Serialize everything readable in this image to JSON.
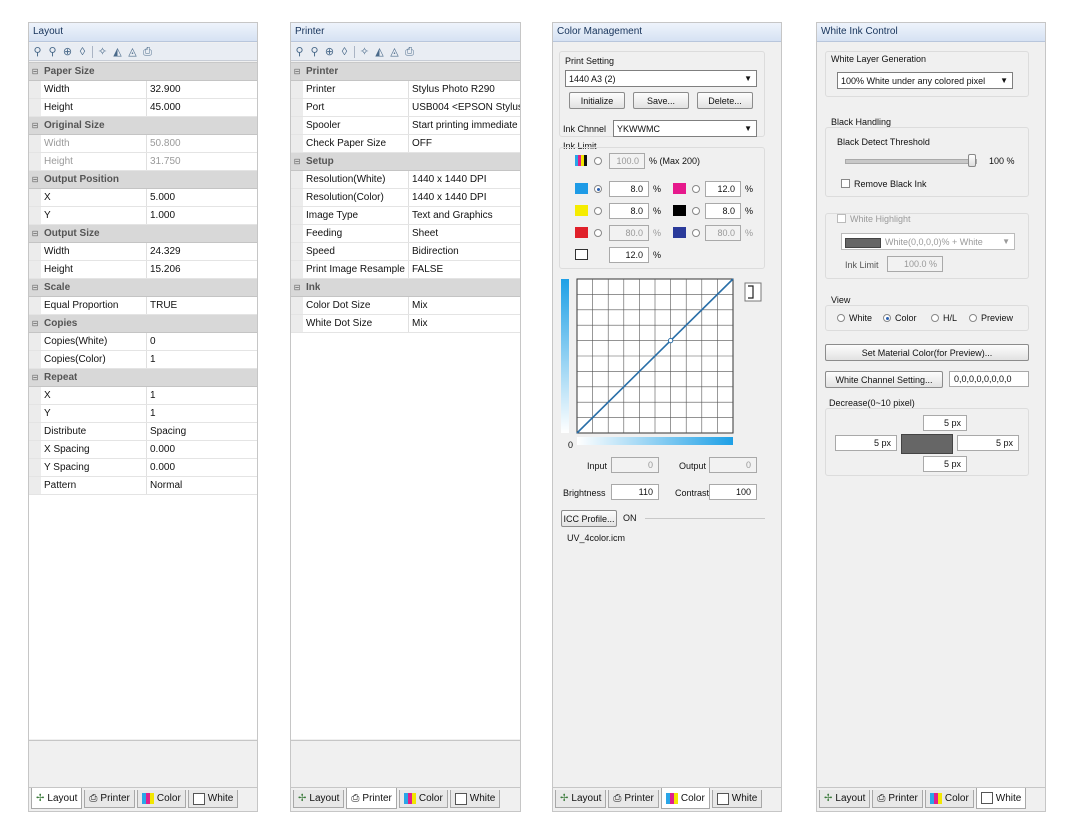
{
  "tabs": [
    {
      "label": "Layout",
      "icon": "layout-icon"
    },
    {
      "label": "Printer",
      "icon": "printer-icon"
    },
    {
      "label": "Color",
      "icon": "color-bars-icon"
    },
    {
      "label": "White",
      "icon": "white-square-icon"
    }
  ],
  "layout_panel": {
    "title": "Layout",
    "rows": [
      {
        "type": "cat",
        "name": "Paper Size"
      },
      {
        "name": "Width",
        "value": "32.900"
      },
      {
        "name": "Height",
        "value": "45.000"
      },
      {
        "type": "cat",
        "name": "Original Size"
      },
      {
        "name": "Width",
        "value": "50.800",
        "disabled": true
      },
      {
        "name": "Height",
        "value": "31.750",
        "disabled": true
      },
      {
        "type": "cat",
        "name": "Output Position"
      },
      {
        "name": "X",
        "value": "5.000"
      },
      {
        "name": "Y",
        "value": "1.000"
      },
      {
        "type": "cat",
        "name": "Output Size"
      },
      {
        "name": "Width",
        "value": "24.329"
      },
      {
        "name": "Height",
        "value": "15.206"
      },
      {
        "type": "cat",
        "name": "Scale"
      },
      {
        "name": "Equal Proportion",
        "value": "TRUE"
      },
      {
        "type": "cat",
        "name": "Copies"
      },
      {
        "name": "Copies(White)",
        "value": "0"
      },
      {
        "name": "Copies(Color)",
        "value": "1"
      },
      {
        "type": "cat",
        "name": "Repeat"
      },
      {
        "name": "X",
        "value": "1"
      },
      {
        "name": "Y",
        "value": "1"
      },
      {
        "name": "Distribute",
        "value": "Spacing"
      },
      {
        "name": "X Spacing",
        "value": "0.000"
      },
      {
        "name": "Y Spacing",
        "value": "0.000"
      },
      {
        "name": "Pattern",
        "value": "Normal"
      }
    ]
  },
  "printer_panel": {
    "title": "Printer",
    "rows": [
      {
        "type": "cat",
        "name": "Printer"
      },
      {
        "name": "Printer",
        "value": "Stylus Photo R290"
      },
      {
        "name": "Port",
        "value": "USB004 <EPSON Stylus"
      },
      {
        "name": "Spooler",
        "value": "Start printing immediate"
      },
      {
        "name": "Check Paper Size",
        "value": "OFF"
      },
      {
        "type": "cat",
        "name": "Setup"
      },
      {
        "name": "Resolution(White)",
        "value": "1440 x 1440 DPI"
      },
      {
        "name": "Resolution(Color)",
        "value": "1440 x 1440 DPI"
      },
      {
        "name": "Image Type",
        "value": "Text and Graphics"
      },
      {
        "name": "Feeding",
        "value": "Sheet"
      },
      {
        "name": "Speed",
        "value": "Bidirection"
      },
      {
        "name": "Print Image Resample",
        "value": "FALSE"
      },
      {
        "type": "cat",
        "name": "Ink"
      },
      {
        "name": "Color Dot Size",
        "value": "Mix"
      },
      {
        "name": "White Dot Size",
        "value": "Mix"
      }
    ]
  },
  "color_panel": {
    "title": "Color Management",
    "print_setting_label": "Print Setting",
    "print_setting_value": "1440 A3 (2)",
    "initialize_label": "Initialize",
    "save_label": "Save...",
    "delete_label": "Delete...",
    "ink_channel_label": "Ink Chnnel",
    "ink_channel_value": "YKWWMC",
    "ink_limit_label": "Ink Limit",
    "total_limit": "100.0",
    "total_limit_suffix": "% (Max 200)",
    "pct": "%",
    "inks": {
      "cyan": {
        "value": "8.0",
        "color": "#1e9be6"
      },
      "magenta": {
        "value": "12.0",
        "color": "#e6198c"
      },
      "yellow": {
        "value": "8.0",
        "color": "#f5ec00"
      },
      "black": {
        "value": "8.0",
        "color": "#000000"
      },
      "red": {
        "value": "80.0",
        "color": "#e0202a"
      },
      "blue": {
        "value": "80.0",
        "color": "#2a3a9a"
      },
      "white": {
        "value": "12.0",
        "color": "#ffffff"
      }
    },
    "curve_zero": "0",
    "input_label": "Input",
    "input_value": "0",
    "output_label": "Output",
    "output_value": "0",
    "brightness_label": "Brightness",
    "brightness_value": "110",
    "contrast_label": "Contrast",
    "contrast_value": "100",
    "icc_button": "ICC Profile...",
    "icc_state": "ON",
    "icc_file": "UV_4color.icm"
  },
  "white_panel": {
    "title": "White Ink Control",
    "layer_gen_label": "White Layer Generation",
    "layer_gen_value": "100% White under any colored pixel",
    "black_handling_label": "Black Handling",
    "black_threshold_label": "Black Detect Threshold",
    "black_threshold_value": "100 %",
    "black_threshold_level": 1.0,
    "remove_black_label": "Remove Black Ink",
    "white_highlight_label": "White Highlight",
    "highlight_value": "White(0,0,0,0)% + White",
    "ink_limit_label": "Ink Limit",
    "ink_limit_value": "100.0 %",
    "view_label": "View",
    "view_options": [
      "White",
      "Color",
      "H/L",
      "Preview"
    ],
    "view_selected": "Color",
    "material_button": "Set Material Color(for Preview)...",
    "channel_button": "White Channel Setting...",
    "channel_value": "0,0,0,0,0,0,0,0",
    "decrease_label": "Decrease(0~10 pixel)",
    "dec_top": "5 px",
    "dec_left": "5 px",
    "dec_right": "5 px",
    "dec_bottom": "5 px"
  }
}
